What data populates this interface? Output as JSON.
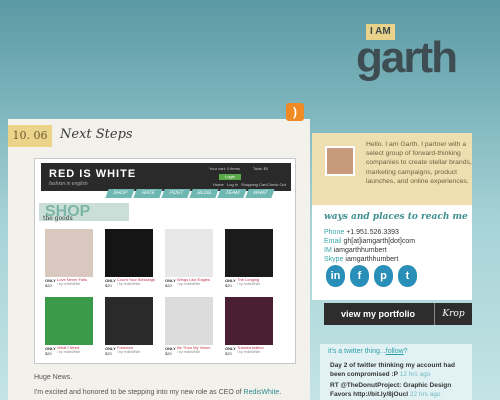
{
  "logo": {
    "tag": "I AM",
    "name": "garth"
  },
  "rss_glyph": ")",
  "post": {
    "date": "10. 06",
    "title": "Next Steps",
    "body_line_1": "Huge News.",
    "body_line_2_prefix": "I'm excited and honored to be stepping into my new role as CEO of ",
    "body_line_2_link": "RedisWhite",
    "body_line_2_suffix": "."
  },
  "screenshot": {
    "brand": "RED IS WHITE",
    "tagline": "fashion in english",
    "top_links": [
      "Your cart: 0 items",
      "Total: $0"
    ],
    "login_label": "Login",
    "account_links": [
      "Home",
      "Log in",
      "Shopping Cart",
      "Check Out"
    ],
    "nav": [
      "SHOP",
      "RATE",
      "POST",
      "BLOG",
      "TEAM",
      "WHAT"
    ],
    "banner": "SHOP",
    "section_title": "the goods",
    "products": [
      {
        "name": "Love Never Fails",
        "label": "ONLY",
        "price": "$20",
        "by": "/ by redisWhite",
        "color": "#d9c8c0"
      },
      {
        "name": "Count Your Blessings",
        "label": "ONLY",
        "price": "$20",
        "by": "/ by redisWhite",
        "color": "#151515"
      },
      {
        "name": "Wings Like Eagles",
        "label": "ONLY",
        "price": "$20",
        "by": "/ by redisWhite",
        "color": "#e8e8e8"
      },
      {
        "name": "The Longing",
        "label": "ONLY",
        "price": "$20",
        "by": "/ by redisWhite",
        "color": "#1b1b1b"
      },
      {
        "name": "What I Need",
        "label": "ONLY",
        "price": "$20",
        "by": "/ by redisWhite",
        "color": "#3a9a4a"
      },
      {
        "name": "Freedom",
        "label": "ONLY",
        "price": "$20",
        "by": "/ by redisWhite",
        "color": "#2a2a2a"
      },
      {
        "name": "Be Thou My Vision",
        "label": "ONLY",
        "price": "$20",
        "by": "/ by redisWhite",
        "color": "#dcdcdc"
      },
      {
        "name": "Transformation",
        "label": "ONLY",
        "price": "$20",
        "by": "/ by redisWhite",
        "color": "#4a1f35"
      }
    ]
  },
  "sidebar": {
    "bio": "Hello. I am Garth. I partner with a select group of forward-thinking companies to create stellar brands, marketing campaigns, product launches, and online experiences.",
    "ways_title": "ways and places to reach me",
    "contacts": [
      {
        "key": "Phone",
        "value": "+1.951.526.3393"
      },
      {
        "key": "Email",
        "value": "gh[at]iamgarth[dot]com"
      },
      {
        "key": "IM",
        "value": "iamgarthhumbert"
      },
      {
        "key": "Skype",
        "value": "iamgarthhumbert"
      }
    ],
    "social": [
      {
        "name": "linkedin",
        "glyph": "in"
      },
      {
        "name": "facebook",
        "glyph": "f"
      },
      {
        "name": "posterous",
        "glyph": "p"
      },
      {
        "name": "twitter",
        "glyph": "t"
      }
    ],
    "portfolio_label": "view my portfolio",
    "portfolio_brand": "Krop",
    "twitter": {
      "head_prefix": "it's a twitter thing...",
      "follow": "follow",
      "head_suffix": "?",
      "tweets": [
        {
          "text": "Day 2 of twitter thinking my account had been compromised :P",
          "time": "12 hrs ago"
        },
        {
          "text": "RT @TheDonutProject: Graphic Design Favors http://bit.ly/8jOucI",
          "time": "22 hrs ago"
        }
      ]
    }
  },
  "colors": {
    "accent": "#3aa6a8",
    "tan": "#ebd38a",
    "sidebar_bio_bg": "#eedeb0",
    "link_red": "#c0334a"
  }
}
